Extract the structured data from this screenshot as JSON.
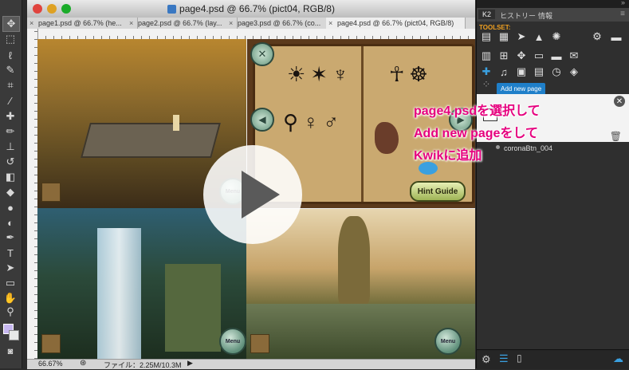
{
  "window": {
    "title": "page4.psd @ 66.7% (pict04, RGB/8)"
  },
  "doc_tabs": [
    {
      "label": "page1.psd @ 66.7% (he..."
    },
    {
      "label": "page2.psd @ 66.7% (lay..."
    },
    {
      "label": "page3.psd @ 66.7% (co..."
    },
    {
      "label": "page4.psd @ 66.7% (pict04, RGB/8)"
    }
  ],
  "status": {
    "zoom": "66.67%",
    "file_info": "ファイル：2.25M/10.3M"
  },
  "canvas": {
    "hint_button": "Hint Guide",
    "menu_label": "Menu"
  },
  "panel": {
    "tabs": [
      "K2",
      "ヒストリー",
      "情報"
    ],
    "toolset_label": "TOOLSET:",
    "tooltip": "Add new page",
    "layer_name": "coronaBtn_004"
  },
  "overlay": {
    "line1": "page4.psdを選択して",
    "line2": "Add new pageをして",
    "line3": "Kwikに追加"
  },
  "colors": {
    "overlay_text": "#e6007e",
    "tooltip_bg": "#1f7fc9",
    "accent_blue": "#3aa0e0"
  }
}
